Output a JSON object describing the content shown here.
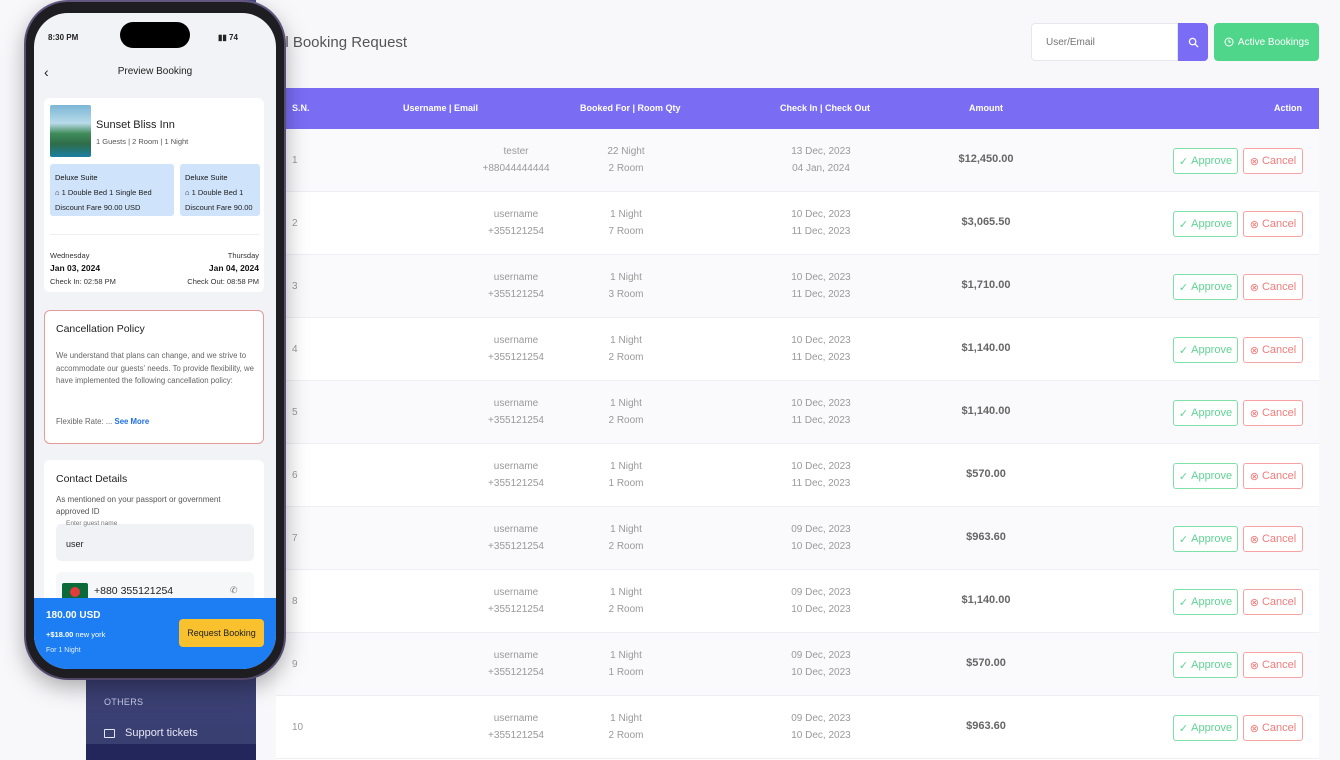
{
  "sidebar": {
    "section_label": "OTHERS",
    "items": [
      {
        "label": "Support tickets"
      }
    ]
  },
  "header": {
    "title": "ll Booking Request",
    "search_placeholder": "User/Email",
    "active_bookings_label": "Active Bookings"
  },
  "table": {
    "columns": [
      "S.N.",
      "Username | Email",
      "Booked For | Room Qty",
      "Check In | Check Out",
      "Amount",
      "Action"
    ],
    "approve_label": "Approve",
    "cancel_label": "Cancel",
    "rows": [
      {
        "sn": "1",
        "user": "tester",
        "contact": "+88044444444",
        "nights": "22 Night",
        "rooms": "2 Room",
        "check_in": "13 Dec, 2023",
        "check_out": "04 Jan, 2024",
        "amount": "$12,450.00"
      },
      {
        "sn": "2",
        "user": "username",
        "contact": "+355121254",
        "nights": "1 Night",
        "rooms": "7 Room",
        "check_in": "10 Dec, 2023",
        "check_out": "11 Dec, 2023",
        "amount": "$3,065.50"
      },
      {
        "sn": "3",
        "user": "username",
        "contact": "+355121254",
        "nights": "1 Night",
        "rooms": "3 Room",
        "check_in": "10 Dec, 2023",
        "check_out": "11 Dec, 2023",
        "amount": "$1,710.00"
      },
      {
        "sn": "4",
        "user": "username",
        "contact": "+355121254",
        "nights": "1 Night",
        "rooms": "2 Room",
        "check_in": "10 Dec, 2023",
        "check_out": "11 Dec, 2023",
        "amount": "$1,140.00"
      },
      {
        "sn": "5",
        "user": "username",
        "contact": "+355121254",
        "nights": "1 Night",
        "rooms": "2 Room",
        "check_in": "10 Dec, 2023",
        "check_out": "11 Dec, 2023",
        "amount": "$1,140.00"
      },
      {
        "sn": "6",
        "user": "username",
        "contact": "+355121254",
        "nights": "1 Night",
        "rooms": "1 Room",
        "check_in": "10 Dec, 2023",
        "check_out": "11 Dec, 2023",
        "amount": "$570.00"
      },
      {
        "sn": "7",
        "user": "username",
        "contact": "+355121254",
        "nights": "1 Night",
        "rooms": "2 Room",
        "check_in": "09 Dec, 2023",
        "check_out": "10 Dec, 2023",
        "amount": "$963.60"
      },
      {
        "sn": "8",
        "user": "username",
        "contact": "+355121254",
        "nights": "1 Night",
        "rooms": "2 Room",
        "check_in": "09 Dec, 2023",
        "check_out": "10 Dec, 2023",
        "amount": "$1,140.00"
      },
      {
        "sn": "9",
        "user": "username",
        "contact": "+355121254",
        "nights": "1 Night",
        "rooms": "1 Room",
        "check_in": "09 Dec, 2023",
        "check_out": "10 Dec, 2023",
        "amount": "$570.00"
      },
      {
        "sn": "10",
        "user": "username",
        "contact": "+355121254",
        "nights": "1 Night",
        "rooms": "2 Room",
        "check_in": "09 Dec, 2023",
        "check_out": "10 Dec, 2023",
        "amount": "$963.60"
      }
    ]
  },
  "phone": {
    "time": "8:30 PM",
    "status_icons": "74",
    "nav_title": "Preview Booking",
    "hotel_name": "Sunset Bliss Inn",
    "hotel_sub": "1 Guests | 2 Room | 1 Night",
    "suites": [
      {
        "name": "Deluxe Suite",
        "beds": "1 Double Bed  1 Single Bed",
        "fare": "Discount Fare 90.00 USD"
      },
      {
        "name": "Deluxe Suite",
        "beds": "1 Double Bed  1",
        "fare": "Discount Fare 90.00"
      }
    ],
    "checkin_day": "Wednesday",
    "checkin_date": "Jan 03, 2024",
    "checkin_time": "Check In: 02:58 PM",
    "checkout_day": "Thursday",
    "checkout_date": "Jan 04, 2024",
    "checkout_time": "Check Out: 08:58 PM",
    "policy_title": "Cancellation Policy",
    "policy_text": "We understand that plans can change, and we strive to accommodate our guests' needs. To provide flexibility, we have implemented the following cancellation policy:",
    "policy_more_prefix": "Flexible Rate: ... ",
    "policy_more_link": "See More",
    "contact_title": "Contact Details",
    "contact_text": "As mentioned on your passport or government approved ID",
    "name_label": "Enter guest name",
    "name_value": "user",
    "phone_number": "+880 355121254",
    "price": "180.00 USD",
    "price_save": "+$18.00",
    "price_save_suffix": " new york",
    "price_night": "For 1 Night",
    "request_label": "Request Booking"
  },
  "colors": {
    "accent": "#7a6df4",
    "success": "#4fd68a",
    "danger": "#f07c7c",
    "phone_cta": "#1c7ef2"
  }
}
